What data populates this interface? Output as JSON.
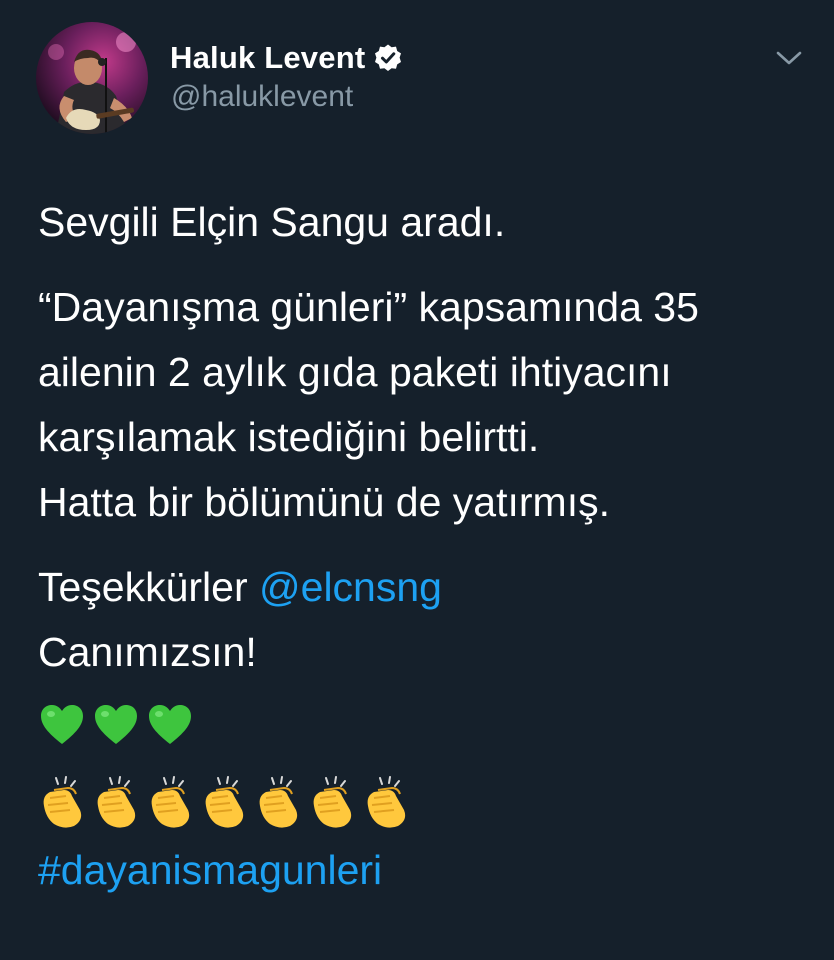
{
  "header": {
    "display_name": "Haluk Levent",
    "handle": "@haluklevent",
    "verified_icon": "verified-badge-icon",
    "menu_icon": "chevron-down-icon"
  },
  "tweet": {
    "line1": "Sevgili Elçin Sangu aradı.",
    "line2": "“Dayanışma günleri” kapsamında 35",
    "line3": "ailenin 2 aylık gıda paketi ihtiyacını",
    "line4": "karşılamak istediğini belirtti.",
    "line5": "Hatta bir bölümünü de yatırmış.",
    "thanks_text": "Teşekkürler ",
    "mention": "@elcnsng",
    "line7": "Canımızsın!",
    "hashtag": "#dayanismagunleri"
  },
  "emoji": {
    "hearts": [
      "green-heart-icon",
      "green-heart-icon",
      "green-heart-icon"
    ],
    "claps": [
      "clapping-hands-icon",
      "clapping-hands-icon",
      "clapping-hands-icon",
      "clapping-hands-icon",
      "clapping-hands-icon",
      "clapping-hands-icon",
      "clapping-hands-icon"
    ]
  },
  "colors": {
    "background": "#15202b",
    "text": "#ffffff",
    "secondary_text": "#8899a6",
    "link": "#1da1f2",
    "heart": "#3ec53e",
    "clap": "#ffc83d"
  }
}
